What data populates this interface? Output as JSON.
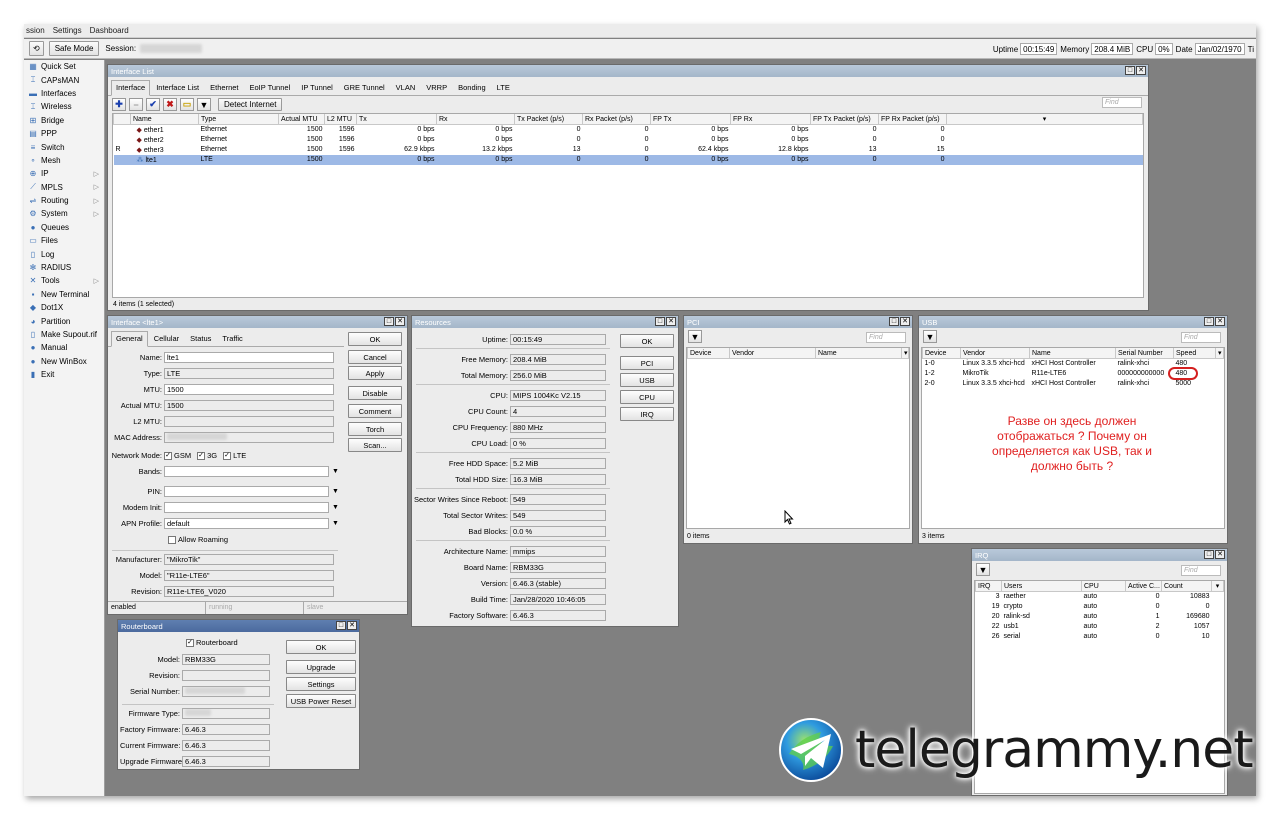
{
  "menu": [
    "ssion",
    "Settings",
    "Dashboard"
  ],
  "toolbar": {
    "safe_mode": "Safe Mode",
    "session_label": "Session:",
    "uptime_label": "Uptime",
    "uptime": "00:15:49",
    "memory_label": "Memory",
    "memory": "208.4 MiB",
    "cpu_label": "CPU",
    "cpu": "0%",
    "date_label": "Date",
    "date": "Jan/02/1970",
    "cut_label": "Ti"
  },
  "sidebar": [
    {
      "label": "Quick Set",
      "icon": "quick-set-icon",
      "glyph": "▦"
    },
    {
      "label": "CAPsMAN",
      "icon": "capsman-icon",
      "glyph": "⌶"
    },
    {
      "label": "Interfaces",
      "icon": "interfaces-icon",
      "glyph": "▬"
    },
    {
      "label": "Wireless",
      "icon": "wireless-icon",
      "glyph": "⌶"
    },
    {
      "label": "Bridge",
      "icon": "bridge-icon",
      "glyph": "⊞"
    },
    {
      "label": "PPP",
      "icon": "ppp-icon",
      "glyph": "▤"
    },
    {
      "label": "Switch",
      "icon": "switch-icon",
      "glyph": "≡"
    },
    {
      "label": "Mesh",
      "icon": "mesh-icon",
      "glyph": "∘"
    },
    {
      "label": "IP",
      "icon": "ip-icon",
      "glyph": "⊕",
      "arrow": true
    },
    {
      "label": "MPLS",
      "icon": "mpls-icon",
      "glyph": "⟋",
      "arrow": true
    },
    {
      "label": "Routing",
      "icon": "routing-icon",
      "glyph": "⇌",
      "arrow": true
    },
    {
      "label": "System",
      "icon": "system-icon",
      "glyph": "⚙",
      "arrow": true
    },
    {
      "label": "Queues",
      "icon": "queues-icon",
      "glyph": "●"
    },
    {
      "label": "Files",
      "icon": "files-icon",
      "glyph": "▭"
    },
    {
      "label": "Log",
      "icon": "log-icon",
      "glyph": "▯"
    },
    {
      "label": "RADIUS",
      "icon": "radius-icon",
      "glyph": "✻"
    },
    {
      "label": "Tools",
      "icon": "tools-icon",
      "glyph": "✕",
      "arrow": true
    },
    {
      "label": "New Terminal",
      "icon": "terminal-icon",
      "glyph": "▪"
    },
    {
      "label": "Dot1X",
      "icon": "dot1x-icon",
      "glyph": "◆"
    },
    {
      "label": "Partition",
      "icon": "partition-icon",
      "glyph": "◕"
    },
    {
      "label": "Make Supout.rif",
      "icon": "supout-icon",
      "glyph": "▯"
    },
    {
      "label": "Manual",
      "icon": "manual-icon",
      "glyph": "●"
    },
    {
      "label": "New WinBox",
      "icon": "winbox-icon",
      "glyph": "●"
    },
    {
      "label": "Exit",
      "icon": "exit-icon",
      "glyph": "▮"
    }
  ],
  "interface_list": {
    "title": "Interface List",
    "tabs": [
      "Interface",
      "Interface List",
      "Ethernet",
      "EoIP Tunnel",
      "IP Tunnel",
      "GRE Tunnel",
      "VLAN",
      "VRRP",
      "Bonding",
      "LTE"
    ],
    "detect_internet": "Detect Internet",
    "find": "Find",
    "columns": [
      "",
      "Name",
      "Type",
      "Actual MTU",
      "L2 MTU",
      "Tx",
      "Rx",
      "Tx Packet (p/s)",
      "Rx Packet (p/s)",
      "FP Tx",
      "FP Rx",
      "FP Tx Packet (p/s)",
      "FP Rx Packet (p/s)"
    ],
    "rows": [
      [
        "",
        "ether1",
        "Ethernet",
        "1500",
        "1596",
        "0 bps",
        "0 bps",
        "0",
        "0",
        "0 bps",
        "0 bps",
        "0",
        "0"
      ],
      [
        "",
        "ether2",
        "Ethernet",
        "1500",
        "1596",
        "0 bps",
        "0 bps",
        "0",
        "0",
        "0 bps",
        "0 bps",
        "0",
        "0"
      ],
      [
        "R",
        "ether3",
        "Ethernet",
        "1500",
        "1596",
        "62.9 kbps",
        "13.2 kbps",
        "13",
        "0",
        "62.4 kbps",
        "12.8 kbps",
        "13",
        "15"
      ],
      [
        "",
        "lte1",
        "LTE",
        "1500",
        "",
        "0 bps",
        "0 bps",
        "0",
        "0",
        "0 bps",
        "0 bps",
        "0",
        "0"
      ]
    ],
    "status": "4 items (1 selected)"
  },
  "interface_lte": {
    "title": "Interface <lte1>",
    "tabs": [
      "General",
      "Cellular",
      "Status",
      "Traffic"
    ],
    "name_label": "Name:",
    "name": "lte1",
    "type_label": "Type:",
    "type": "LTE",
    "mtu_label": "MTU:",
    "mtu": "1500",
    "actual_mtu_label": "Actual MTU:",
    "actual_mtu": "1500",
    "l2mtu_label": "L2 MTU:",
    "mac_label": "MAC Address:",
    "network_mode_label": "Network Mode:",
    "modes": [
      "GSM",
      "3G",
      "LTE"
    ],
    "bands_label": "Bands:",
    "pin_label": "PIN:",
    "modem_init_label": "Modem Init:",
    "apn_label": "APN Profile:",
    "apn": "default",
    "allow_roaming": "Allow Roaming",
    "manufacturer_label": "Manufacturer:",
    "manufacturer": "\"MikroTik\"",
    "model_label": "Model:",
    "model": "\"R11e-LTE6\"",
    "revision_label": "Revision:",
    "revision": "R11e-LTE6_V020",
    "buttons": [
      "OK",
      "Cancel",
      "Apply",
      "Disable",
      "Comment",
      "Torch",
      "Scan..."
    ],
    "status": [
      "enabled",
      "running",
      "slave"
    ]
  },
  "resources": {
    "title": "Resources",
    "fields": [
      {
        "label": "Uptime:",
        "value": "00:15:49"
      },
      {
        "label": "Free Memory:",
        "value": "208.4 MiB"
      },
      {
        "label": "Total Memory:",
        "value": "256.0 MiB"
      },
      {
        "label": "CPU:",
        "value": "MIPS 1004Kc V2.15"
      },
      {
        "label": "CPU Count:",
        "value": "4"
      },
      {
        "label": "CPU Frequency:",
        "value": "880 MHz"
      },
      {
        "label": "CPU Load:",
        "value": "0 %"
      },
      {
        "label": "Free HDD Space:",
        "value": "5.2 MiB"
      },
      {
        "label": "Total HDD Size:",
        "value": "16.3 MiB"
      },
      {
        "label": "Sector Writes Since Reboot:",
        "value": "549"
      },
      {
        "label": "Total Sector Writes:",
        "value": "549"
      },
      {
        "label": "Bad Blocks:",
        "value": "0.0 %"
      },
      {
        "label": "Architecture Name:",
        "value": "mmips"
      },
      {
        "label": "Board Name:",
        "value": "RBM33G"
      },
      {
        "label": "Version:",
        "value": "6.46.3 (stable)"
      },
      {
        "label": "Build Time:",
        "value": "Jan/28/2020 10:46:05"
      },
      {
        "label": "Factory Software:",
        "value": "6.46.3"
      }
    ],
    "buttons": [
      "OK",
      "PCI",
      "USB",
      "CPU",
      "IRQ"
    ]
  },
  "pci": {
    "title": "PCI",
    "find": "Find",
    "columns": [
      "Device",
      "Vendor",
      "Name"
    ],
    "status": "0 items"
  },
  "usb": {
    "title": "USB",
    "find": "Find",
    "columns": [
      "Device",
      "Vendor",
      "Name",
      "Serial Number",
      "Speed"
    ],
    "rows": [
      [
        "1-0",
        "Linux 3.3.5 xhci-hcd",
        "xHCI Host Controller",
        "ralink-xhci",
        "480"
      ],
      [
        "1-2",
        "MikroTik",
        "R11e-LTE6",
        "000000000000",
        "480"
      ],
      [
        "2-0",
        "Linux 3.3.5 xhci-hcd",
        "xHCI Host Controller",
        "ralink-xhci",
        "5000"
      ]
    ],
    "status": "3 items"
  },
  "irq": {
    "title": "IRQ",
    "find": "Find",
    "columns": [
      "IRQ",
      "Users",
      "CPU",
      "Active C...",
      "Count"
    ],
    "rows": [
      [
        "3",
        "raether",
        "auto",
        "0",
        "10883"
      ],
      [
        "19",
        "crypto",
        "auto",
        "0",
        "0"
      ],
      [
        "20",
        "ralink-sd",
        "auto",
        "1",
        "169680"
      ],
      [
        "22",
        "usb1",
        "auto",
        "2",
        "1057"
      ],
      [
        "26",
        "serial",
        "auto",
        "0",
        "10"
      ]
    ]
  },
  "routerboard": {
    "title": "Routerboard",
    "check_label": "Routerboard",
    "model_label": "Model:",
    "model": "RBM33G",
    "revision_label": "Revision:",
    "serial_label": "Serial Number:",
    "firmware_type_label": "Firmware Type:",
    "factory_fw_label": "Factory Firmware:",
    "factory_fw": "6.46.3",
    "current_fw_label": "Current Firmware:",
    "current_fw": "6.46.3",
    "upgrade_fw_label": "Upgrade Firmware:",
    "upgrade_fw": "6.46.3",
    "buttons": [
      "OK",
      "Upgrade",
      "Settings",
      "USB Power Reset"
    ]
  },
  "annotation": "Разве он здесь должен отображаться ? Почему он определяется как USB, так и должно быть ?",
  "watermark": "telegrammy.net"
}
